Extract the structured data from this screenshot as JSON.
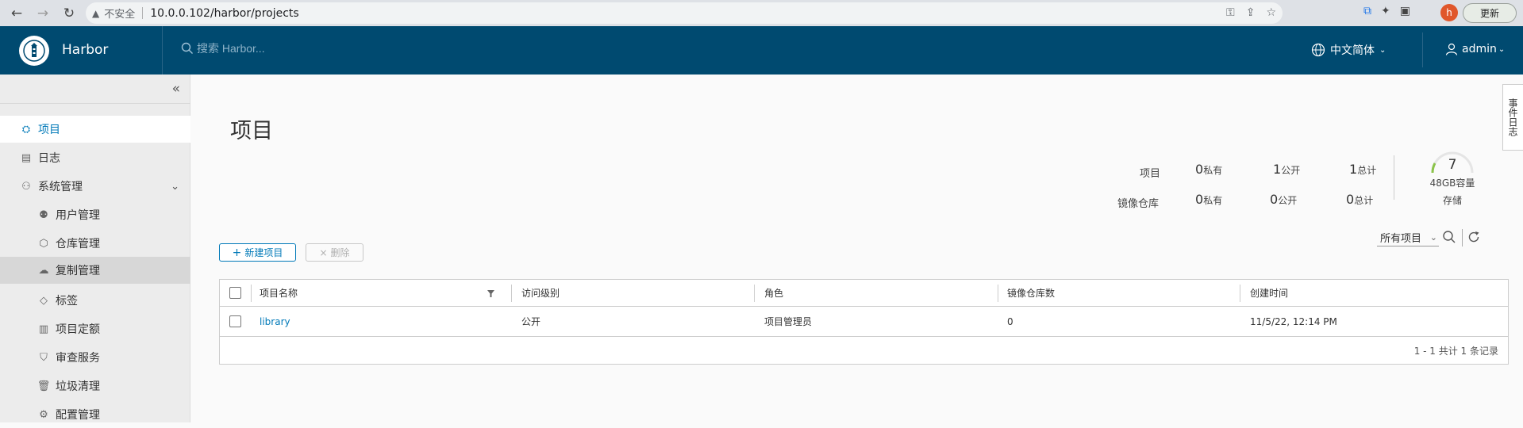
{
  "browser": {
    "insecure_label": "不安全",
    "url": "10.0.0.102/harbor/projects",
    "profile_initial": "h",
    "update_label": "更新"
  },
  "header": {
    "app_title": "Harbor",
    "search_placeholder": "搜索 Harbor...",
    "language": "中文简体",
    "user": "admin"
  },
  "sidebar": {
    "items": [
      {
        "label": "项目",
        "icon": "projects-icon"
      },
      {
        "label": "日志",
        "icon": "logs-icon"
      },
      {
        "label": "系统管理",
        "icon": "admin-icon"
      },
      {
        "label": "用户管理",
        "icon": "users-icon"
      },
      {
        "label": "仓库管理",
        "icon": "registry-icon"
      },
      {
        "label": "复制管理",
        "icon": "replication-icon"
      },
      {
        "label": "标签",
        "icon": "tag-icon"
      },
      {
        "label": "项目定额",
        "icon": "quota-icon"
      },
      {
        "label": "审查服务",
        "icon": "shield-icon"
      },
      {
        "label": "垃圾清理",
        "icon": "trash-icon"
      },
      {
        "label": "配置管理",
        "icon": "gear-icon"
      }
    ]
  },
  "main": {
    "title": "项目",
    "stats": {
      "row_projects_label": "项目",
      "row_repos_label": "镜像仓库",
      "private_unit": "私有",
      "public_unit": "公开",
      "total_unit": "总计",
      "projects_private": "0",
      "projects_public": "1",
      "projects_total": "1",
      "repos_private": "0",
      "repos_public": "0",
      "repos_total": "0"
    },
    "quota": {
      "count": "7",
      "capacity": "48GB容量",
      "storage_label": "存储"
    },
    "toolbar": {
      "new_project": "新建项目",
      "delete": "删除",
      "filter_selected": "所有项目"
    },
    "table": {
      "headers": [
        "项目名称",
        "访问级别",
        "角色",
        "镜像仓库数",
        "创建时间"
      ],
      "rows": [
        [
          "library",
          "公开",
          "项目管理员",
          "0",
          "11/5/22, 12:14 PM"
        ]
      ],
      "footer": "1 - 1 共计 1 条记录"
    },
    "side_tab": "事件日志"
  },
  "colors": {
    "header_bg": "#004a70",
    "accent": "#0079b8",
    "sidebar_bg": "#ececec"
  }
}
